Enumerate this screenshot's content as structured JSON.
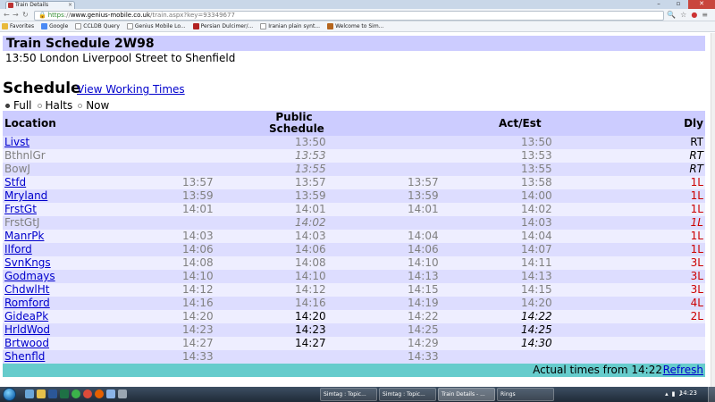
{
  "browser": {
    "tab_title": "Train Details",
    "tab_close": "×",
    "window_controls": [
      "–",
      "▫",
      "✕"
    ],
    "url_scheme": "https",
    "url_host": "www.genius-mobile.co.uk",
    "url_rest": "/train.aspx?key=93349677",
    "bookmarks": [
      {
        "label": "Favorites",
        "color": "#e8b93a"
      },
      {
        "label": "Google",
        "color": "#4a8af4"
      },
      {
        "label": "CCLDB Query",
        "color": "#888888"
      },
      {
        "label": "Genius Mobile Lo...",
        "color": "#888888"
      },
      {
        "label": "Persian Dulcimer/...",
        "color": "#b22222"
      },
      {
        "label": "Iranian plain synt...",
        "color": "#888888"
      },
      {
        "label": "Welcome to Sim...",
        "color": "#b5651d"
      }
    ]
  },
  "page": {
    "title": "Train Schedule 2W98",
    "subtitle": "13:50 London Liverpool Street to Shenfield",
    "schedule_heading": "Schedule",
    "working_times_link": "View Working Times",
    "radios": [
      {
        "label": "Full",
        "checked": true
      },
      {
        "label": "Halts",
        "checked": false
      },
      {
        "label": "Now",
        "checked": false
      }
    ]
  },
  "table": {
    "headers": {
      "location": "Location",
      "public_line1": "Public",
      "public_line2": "Schedule",
      "act_est": "Act/Est",
      "dly": "Dly"
    },
    "rows": [
      {
        "loc": "Livst",
        "link": true,
        "wtt": "",
        "pub": "13:50",
        "pub_style": "g",
        "wact": "",
        "act": "13:50",
        "act_style": "g",
        "dly": "RT",
        "dly_style": "k"
      },
      {
        "loc": "BthnlGr",
        "link": false,
        "wtt": "",
        "pub": "13:53",
        "pub_style": "g it",
        "wact": "",
        "act": "13:53",
        "act_style": "g",
        "dly": "RT",
        "dly_style": "k it"
      },
      {
        "loc": "BowJ",
        "link": false,
        "wtt": "",
        "pub": "13:55",
        "pub_style": "g it",
        "wact": "",
        "act": "13:55",
        "act_style": "g",
        "dly": "RT",
        "dly_style": "k it"
      },
      {
        "loc": "Stfd",
        "link": true,
        "wtt": "13:57",
        "pub": "13:57",
        "pub_style": "g",
        "wact": "13:57",
        "act": "13:58",
        "act_style": "g",
        "dly": "1L",
        "dly_style": "red"
      },
      {
        "loc": "Mryland",
        "link": true,
        "wtt": "13:59",
        "pub": "13:59",
        "pub_style": "g",
        "wact": "13:59",
        "act": "14:00",
        "act_style": "g",
        "dly": "1L",
        "dly_style": "red"
      },
      {
        "loc": "FrstGt",
        "link": true,
        "wtt": "14:01",
        "pub": "14:01",
        "pub_style": "g",
        "wact": "14:01",
        "act": "14:02",
        "act_style": "g",
        "dly": "1L",
        "dly_style": "red"
      },
      {
        "loc": "FrstGtJ",
        "link": false,
        "wtt": "",
        "pub": "14:02",
        "pub_style": "g it",
        "wact": "",
        "act": "14:03",
        "act_style": "g",
        "dly": "1L",
        "dly_style": "red it"
      },
      {
        "loc": "ManrPk",
        "link": true,
        "wtt": "14:03",
        "pub": "14:03",
        "pub_style": "g",
        "wact": "14:04",
        "act": "14:04",
        "act_style": "g",
        "dly": "1L",
        "dly_style": "red"
      },
      {
        "loc": "Ilford",
        "link": true,
        "wtt": "14:06",
        "pub": "14:06",
        "pub_style": "g",
        "wact": "14:06",
        "act": "14:07",
        "act_style": "g",
        "dly": "1L",
        "dly_style": "red"
      },
      {
        "loc": "SvnKngs",
        "link": true,
        "wtt": "14:08",
        "pub": "14:08",
        "pub_style": "g",
        "wact": "14:10",
        "act": "14:11",
        "act_style": "g",
        "dly": "3L",
        "dly_style": "red"
      },
      {
        "loc": "Godmays",
        "link": true,
        "wtt": "14:10",
        "pub": "14:10",
        "pub_style": "g",
        "wact": "14:13",
        "act": "14:13",
        "act_style": "g",
        "dly": "3L",
        "dly_style": "red"
      },
      {
        "loc": "ChdwlHt",
        "link": true,
        "wtt": "14:12",
        "pub": "14:12",
        "pub_style": "g",
        "wact": "14:15",
        "act": "14:15",
        "act_style": "g",
        "dly": "3L",
        "dly_style": "red"
      },
      {
        "loc": "Romford",
        "link": true,
        "wtt": "14:16",
        "pub": "14:16",
        "pub_style": "g",
        "wact": "14:19",
        "act": "14:20",
        "act_style": "g",
        "dly": "4L",
        "dly_style": "red"
      },
      {
        "loc": "GideaPk",
        "link": true,
        "wtt": "14:20",
        "pub": "14:20",
        "pub_style": "k",
        "wact": "14:22",
        "act": "14:22",
        "act_style": "k it",
        "dly": "2L",
        "dly_style": "red"
      },
      {
        "loc": "HrldWod",
        "link": true,
        "wtt": "14:23",
        "pub": "14:23",
        "pub_style": "k",
        "wact": "14:25",
        "act": "14:25",
        "act_style": "k it",
        "dly": "",
        "dly_style": "k"
      },
      {
        "loc": "Brtwood",
        "link": true,
        "wtt": "14:27",
        "pub": "14:27",
        "pub_style": "k",
        "wact": "14:29",
        "act": "14:30",
        "act_style": "k it",
        "dly": "",
        "dly_style": "k"
      },
      {
        "loc": "Shenfld",
        "link": true,
        "wtt": "14:33",
        "pub": "",
        "pub_style": "k",
        "wact": "14:33",
        "act": "",
        "act_style": "k it",
        "dly": "",
        "dly_style": "k"
      }
    ],
    "footer_text": "Actual times from 14:22",
    "refresh_label": "Refresh"
  },
  "taskbar": {
    "buttons": [
      {
        "label": "Simtag : Topic...",
        "active": false
      },
      {
        "label": "Simtag : Topic...",
        "active": false
      },
      {
        "label": "Train Details - ...",
        "active": true
      },
      {
        "label": "Rings",
        "active": false
      }
    ],
    "clock": "14:23"
  }
}
